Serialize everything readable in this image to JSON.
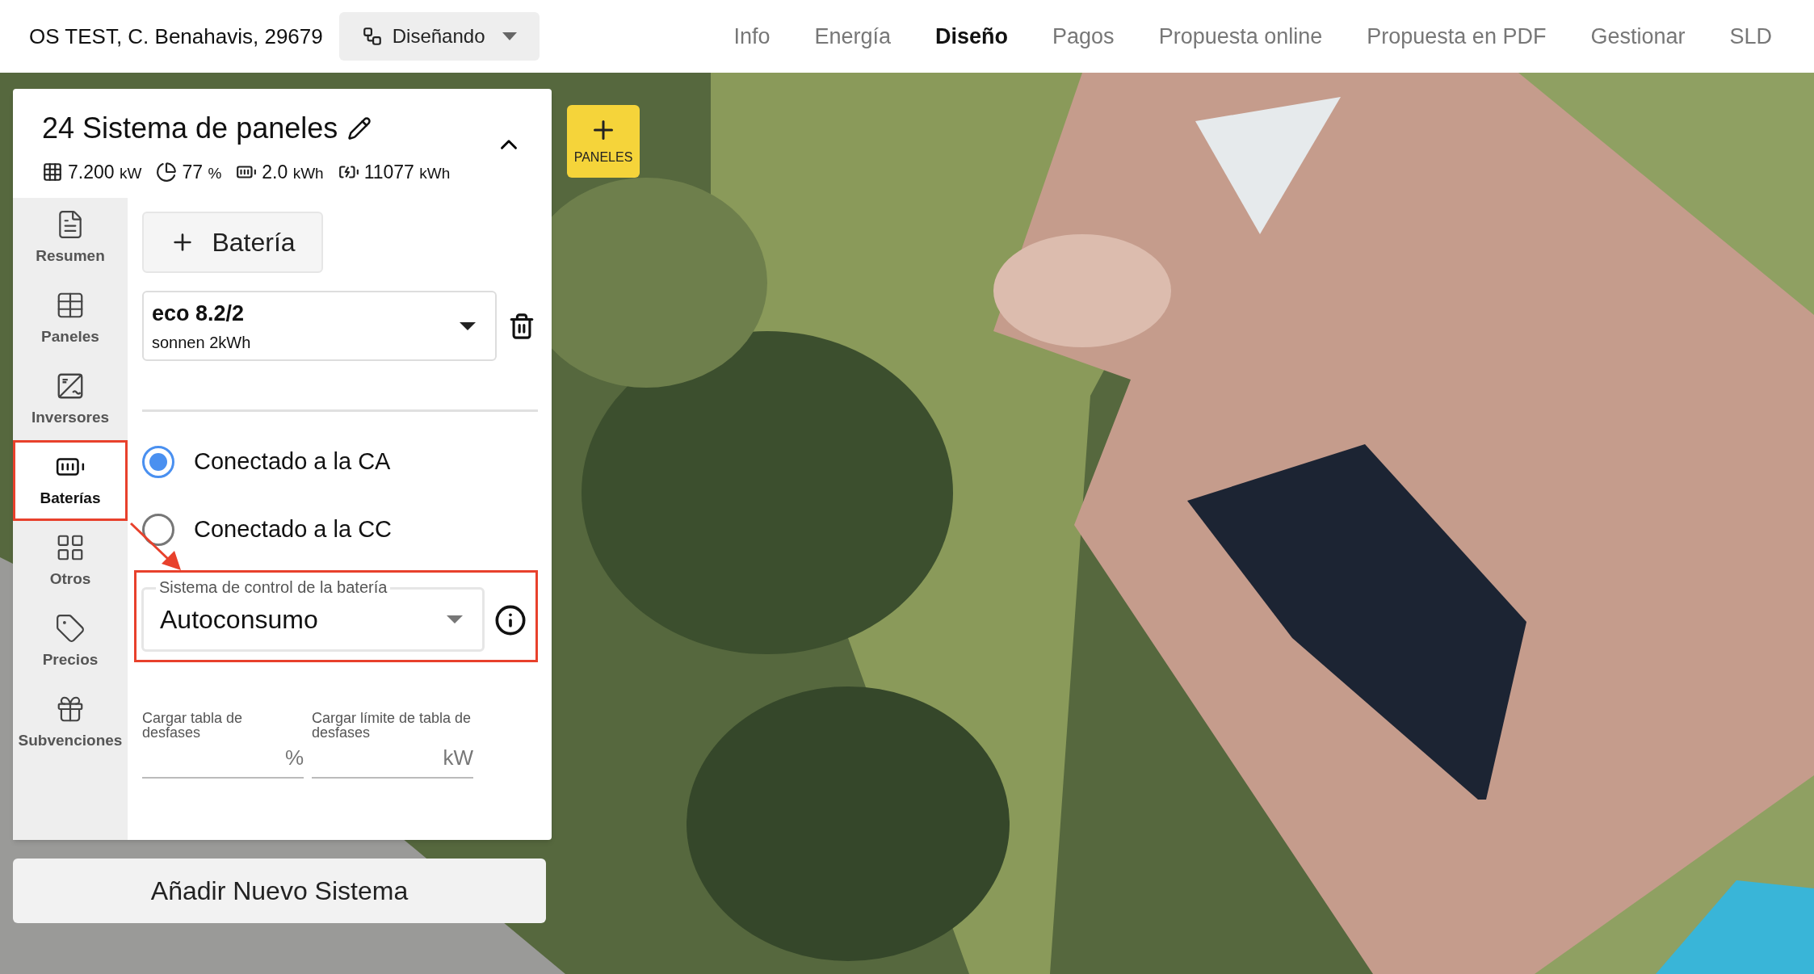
{
  "header": {
    "address": "OS TEST, C. Benahavis, 29679",
    "status": "Diseñando",
    "nav": [
      {
        "label": "Info",
        "selected": false
      },
      {
        "label": "Energía",
        "selected": false
      },
      {
        "label": "Diseño",
        "selected": true
      },
      {
        "label": "Pagos",
        "selected": false
      },
      {
        "label": "Propuesta online",
        "selected": false
      },
      {
        "label": "Propuesta en PDF",
        "selected": false
      },
      {
        "label": "Gestionar",
        "selected": false
      },
      {
        "label": "SLD",
        "selected": false
      }
    ]
  },
  "map_add_button": "PANELES",
  "system": {
    "title": "24 Sistema de paneles",
    "expanded": true,
    "stats": [
      {
        "kind": "panels",
        "value": "7.200",
        "unit": "kW"
      },
      {
        "kind": "offset",
        "value": "77",
        "unit": "%"
      },
      {
        "kind": "battery",
        "value": "2.0",
        "unit": "kWh"
      },
      {
        "kind": "energy",
        "value": "11077",
        "unit": "kWh"
      }
    ],
    "sidebar": [
      {
        "kind": "summary",
        "label": "Resumen",
        "selected": false,
        "highlighted": false
      },
      {
        "kind": "panels",
        "label": "Paneles",
        "selected": false,
        "highlighted": false
      },
      {
        "kind": "inverters",
        "label": "Inversores",
        "selected": false,
        "highlighted": false
      },
      {
        "kind": "batteries",
        "label": "Baterías",
        "selected": true,
        "highlighted": true
      },
      {
        "kind": "others",
        "label": "Otros",
        "selected": false,
        "highlighted": false
      },
      {
        "kind": "prices",
        "label": "Precios",
        "selected": false,
        "highlighted": false
      },
      {
        "kind": "subsidies",
        "label": "Subvenciones",
        "selected": false,
        "highlighted": false
      }
    ],
    "add_battery": "Batería",
    "battery": {
      "model": "eco 8.2/2",
      "detail": "sonnen 2kWh"
    },
    "connection": [
      {
        "label": "Conectado a la CA",
        "selected": true
      },
      {
        "label": "Conectado a la CC",
        "selected": false
      }
    ],
    "control": {
      "label": "Sistema de control de la batería",
      "value": "Autoconsumo",
      "highlighted": true
    },
    "fields": [
      {
        "label": "Cargar tabla de desfases",
        "unit": "%"
      },
      {
        "label": "Cargar límite de tabla de desfases",
        "unit": "kW"
      }
    ]
  },
  "add_system": "Añadir Nuevo Sistema"
}
